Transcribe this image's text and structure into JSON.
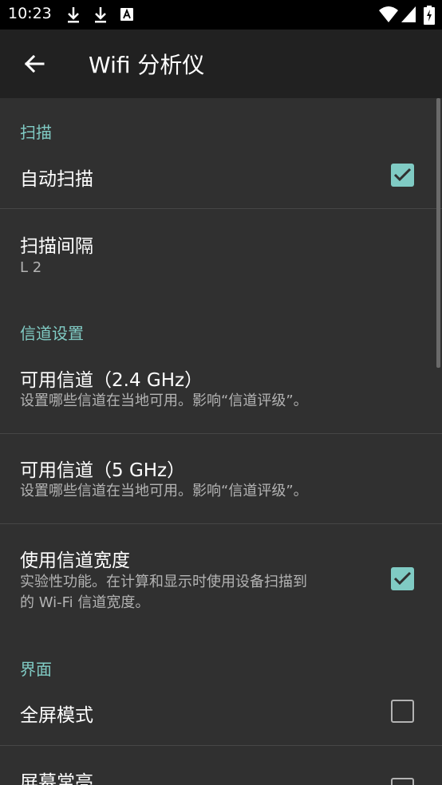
{
  "status_bar": {
    "time": "10:23"
  },
  "app_bar": {
    "title": "Wifi 分析仪"
  },
  "sections": {
    "scan": {
      "header": "扫描",
      "auto_scan": {
        "title": "自动扫描",
        "checked": true
      },
      "scan_interval": {
        "title": "扫描间隔",
        "value": "L 2"
      }
    },
    "channel": {
      "header": "信道设置",
      "ch24": {
        "title": "可用信道（2.4 GHz）",
        "summary": "设置哪些信道在当地可用。影响“信道评级”。"
      },
      "ch5": {
        "title": "可用信道（5 GHz）",
        "summary": "设置哪些信道在当地可用。影响“信道评级”。"
      },
      "width": {
        "title": "使用信道宽度",
        "summary_line1": "实验性功能。在计算和显示时使用设备扫描到",
        "summary_line2": "的 Wi-Fi 信道宽度。",
        "checked": true
      }
    },
    "ui": {
      "header": "界面",
      "fullscreen": {
        "title": "全屏模式",
        "checked": false
      },
      "screen_on": {
        "title": "屏幕常亮",
        "checked": false
      }
    }
  },
  "colors": {
    "accent": "#80cbc4",
    "background": "#303030",
    "app_bar": "#212121"
  }
}
